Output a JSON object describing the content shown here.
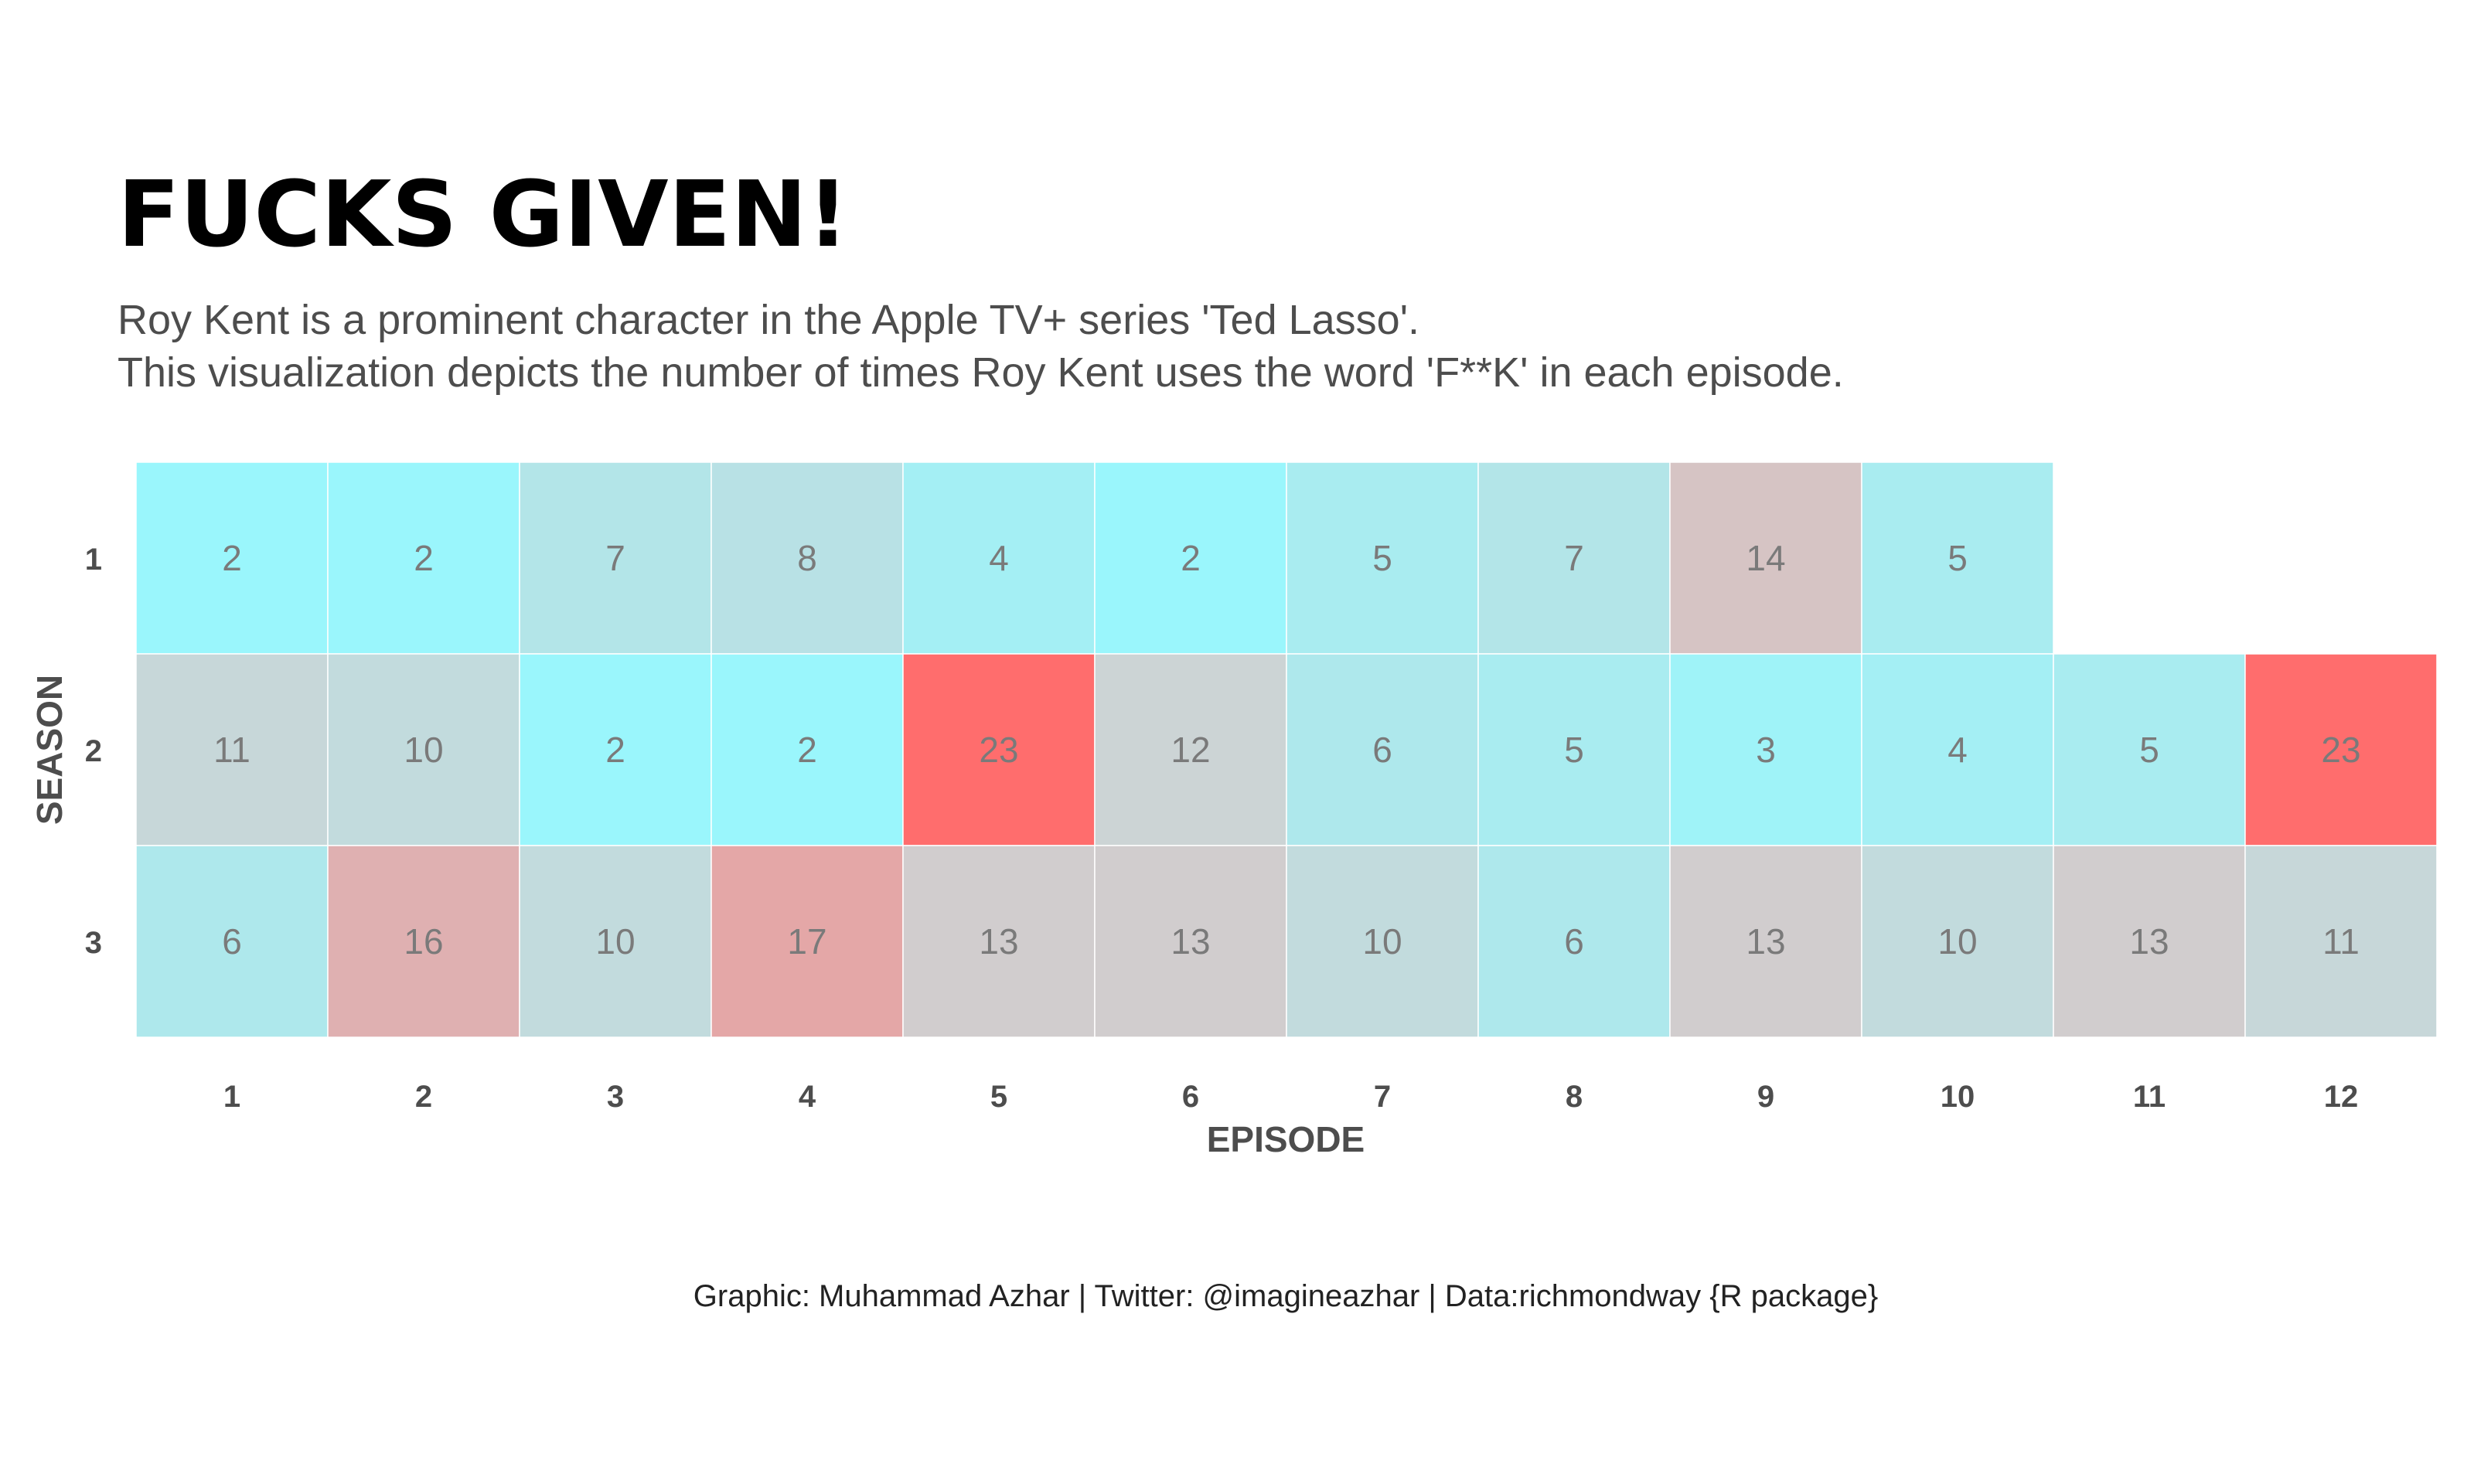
{
  "chart_data": {
    "type": "heatmap",
    "title": "FUCKS GIVEN!",
    "subtitle_lines": [
      "Roy Kent is a prominent character in the Apple TV+ series 'Ted Lasso'.",
      "This visualization depicts the number of times Roy Kent uses the word 'F**K' in each episode."
    ],
    "xlabel": "EPISODE",
    "ylabel": "SEASON",
    "x_categories": [
      "1",
      "2",
      "3",
      "4",
      "5",
      "6",
      "7",
      "8",
      "9",
      "10",
      "11",
      "12"
    ],
    "y_categories": [
      "1",
      "2",
      "3"
    ],
    "values": [
      [
        2,
        2,
        7,
        8,
        4,
        2,
        5,
        7,
        14,
        5,
        null,
        null
      ],
      [
        11,
        10,
        2,
        2,
        23,
        12,
        6,
        5,
        3,
        4,
        5,
        23
      ],
      [
        6,
        16,
        10,
        17,
        13,
        13,
        10,
        6,
        13,
        10,
        13,
        11
      ]
    ],
    "color_scale": {
      "low": "#9af6fc",
      "mid": "#cfd2d3",
      "high": "#ff6d6d",
      "low_value": 2,
      "high_value": 23
    },
    "grid": false,
    "legend": "none",
    "caption": "Graphic: Muhammad Azhar | Twitter: @imagineazhar | Data:richmondway {R package}"
  }
}
